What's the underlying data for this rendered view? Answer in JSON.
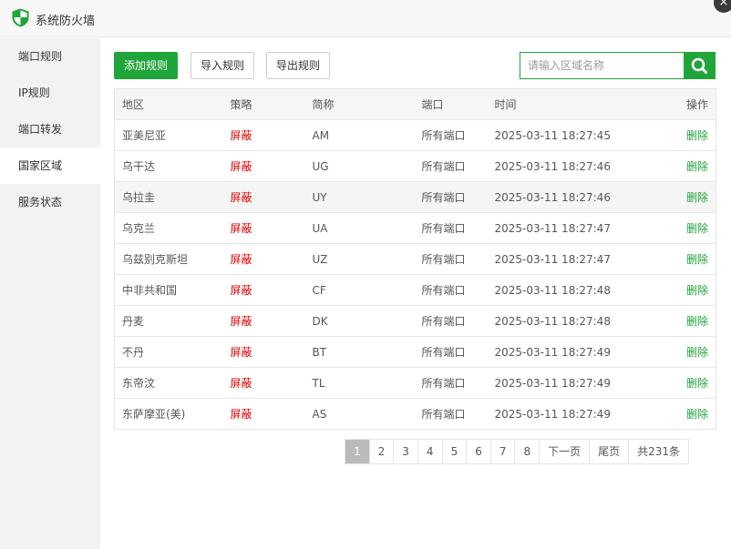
{
  "window": {
    "title": "系统防火墙",
    "close_glyph": "×",
    "accent": "#20a53a"
  },
  "sidebar": {
    "items": [
      {
        "label": "端口规则",
        "active": false
      },
      {
        "label": "IP规则",
        "active": false
      },
      {
        "label": "端口转发",
        "active": false
      },
      {
        "label": "国家区域",
        "active": true
      },
      {
        "label": "服务状态",
        "active": false
      }
    ]
  },
  "toolbar": {
    "add_label": "添加规则",
    "import_label": "导入规则",
    "export_label": "导出规则",
    "search_placeholder": "请输入区域名称",
    "search_icon": "search-icon"
  },
  "table": {
    "headers": [
      "地区",
      "策略",
      "简称",
      "端口",
      "时间",
      "操作"
    ],
    "rows": [
      {
        "region": "亚美尼亚",
        "policy": "屏蔽",
        "abbr": "AM",
        "port": "所有端口",
        "time": "2025-03-11 18:27:45",
        "action": "删除"
      },
      {
        "region": "乌干达",
        "policy": "屏蔽",
        "abbr": "UG",
        "port": "所有端口",
        "time": "2025-03-11 18:27:46",
        "action": "删除"
      },
      {
        "region": "乌拉圭",
        "policy": "屏蔽",
        "abbr": "UY",
        "port": "所有端口",
        "time": "2025-03-11 18:27:46",
        "action": "删除"
      },
      {
        "region": "乌克兰",
        "policy": "屏蔽",
        "abbr": "UA",
        "port": "所有端口",
        "time": "2025-03-11 18:27:47",
        "action": "删除"
      },
      {
        "region": "乌兹别克斯坦",
        "policy": "屏蔽",
        "abbr": "UZ",
        "port": "所有端口",
        "time": "2025-03-11 18:27:47",
        "action": "删除"
      },
      {
        "region": "中非共和国",
        "policy": "屏蔽",
        "abbr": "CF",
        "port": "所有端口",
        "time": "2025-03-11 18:27:48",
        "action": "删除"
      },
      {
        "region": "丹麦",
        "policy": "屏蔽",
        "abbr": "DK",
        "port": "所有端口",
        "time": "2025-03-11 18:27:48",
        "action": "删除"
      },
      {
        "region": "不丹",
        "policy": "屏蔽",
        "abbr": "BT",
        "port": "所有端口",
        "time": "2025-03-11 18:27:49",
        "action": "删除"
      },
      {
        "region": "东帝汶",
        "policy": "屏蔽",
        "abbr": "TL",
        "port": "所有端口",
        "time": "2025-03-11 18:27:49",
        "action": "删除"
      },
      {
        "region": "东萨摩亚(美)",
        "policy": "屏蔽",
        "abbr": "AS",
        "port": "所有端口",
        "time": "2025-03-11 18:27:49",
        "action": "删除"
      }
    ]
  },
  "pagination": {
    "pages": [
      "1",
      "2",
      "3",
      "4",
      "5",
      "6",
      "7",
      "8"
    ],
    "current": "1",
    "next_label": "下一页",
    "last_label": "尾页",
    "total_label": "共231条"
  }
}
